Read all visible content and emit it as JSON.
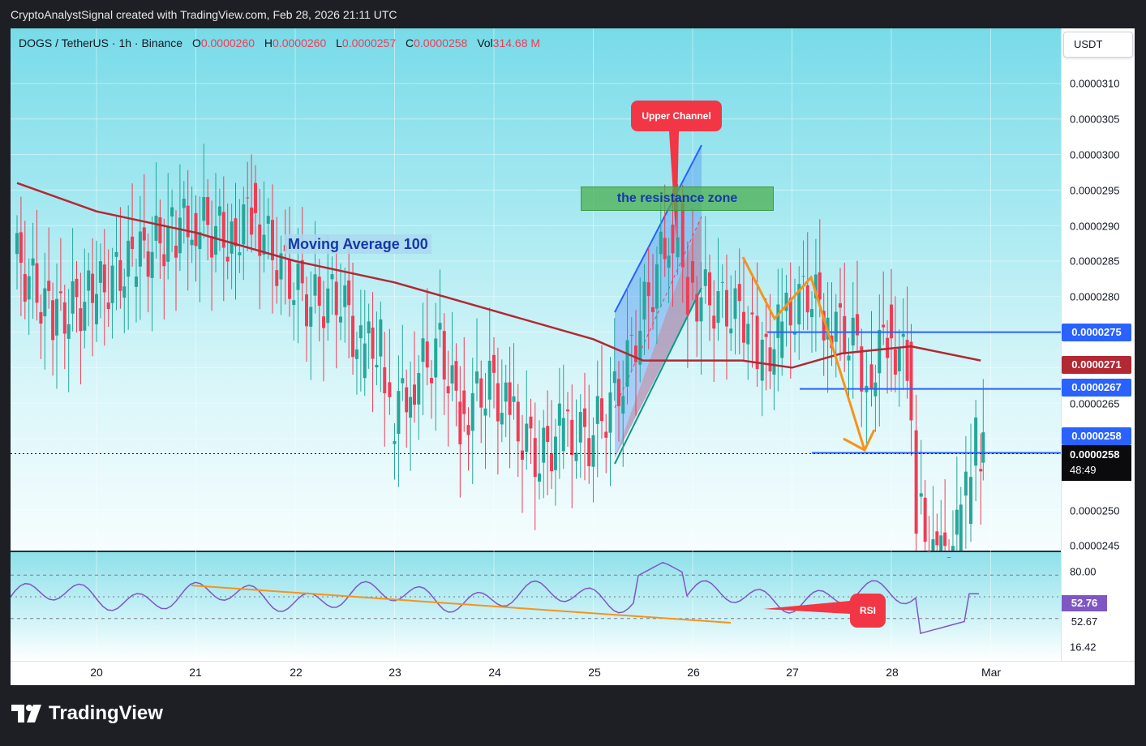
{
  "caption": "CryptoAnalystSignal created with TradingView.com, Feb 28, 2026 21:11 UTC",
  "legend": {
    "symbol": "DOGS / TetherUS · 1h · Binance",
    "o_label": "O",
    "o_value": "0.0000260",
    "h_label": "H",
    "h_value": "0.0000260",
    "l_label": "L",
    "l_value": "0.0000257",
    "c_label": "C",
    "c_value": "0.0000258",
    "vol_label": "Vol",
    "vol_value": "314.68 M"
  },
  "currency_button": "USDT",
  "price_axis_ticks": [
    "0.0000310",
    "0.0000305",
    "0.0000300",
    "0.0000295",
    "0.0000290",
    "0.0000285",
    "0.0000280",
    "0.0000265",
    "0.0000250",
    "0.0000245"
  ],
  "price_tags": {
    "level_275": "0.0000275",
    "ma_271": "0.0000271",
    "level_267": "0.0000267",
    "last_258": "0.0000258",
    "current_price": "0.0000258",
    "countdown": "48:49"
  },
  "rsi_axis": {
    "upper": "80.00",
    "rsi_value": "52.76",
    "ma_value": "52.67",
    "low": "16.42"
  },
  "time_axis": [
    "20",
    "21",
    "22",
    "23",
    "24",
    "25",
    "26",
    "27",
    "28",
    "Mar"
  ],
  "annotations": {
    "moving_average": "Moving Average 100",
    "resistance_zone": "the resistance zone",
    "upper_channel": "Upper Channel",
    "rsi_callout": "RSI"
  },
  "brand": "TradingView",
  "colors": {
    "up": "#26a69a",
    "down": "#ef3d56",
    "ma": "#b22833",
    "level_line": "#2962ff",
    "arrow": "#f7931a"
  },
  "chart_data": {
    "type": "candlestick",
    "interval": "1h",
    "title": "DOGS / TetherUS · 1h · Binance",
    "x_labels": [
      "20",
      "21",
      "22",
      "23",
      "24",
      "25",
      "26",
      "27",
      "28",
      "Mar"
    ],
    "price_path": [
      [
        "19.2",
        2.86e-05
      ],
      [
        "19.6",
        2.77e-05
      ],
      [
        "20.0",
        2.8e-05
      ],
      [
        "20.4",
        2.85e-05
      ],
      [
        "20.8",
        2.89e-05
      ],
      [
        "21.0",
        2.91e-05
      ],
      [
        "21.4",
        2.88e-05
      ],
      [
        "21.6",
        2.92e-05
      ],
      [
        "21.9",
        2.84e-05
      ],
      [
        "22.2",
        2.79e-05
      ],
      [
        "22.5",
        2.8e-05
      ],
      [
        "22.7",
        2.72e-05
      ],
      [
        "22.9",
        2.74e-05
      ],
      [
        "23.0",
        2.62e-05
      ],
      [
        "23.2",
        2.68e-05
      ],
      [
        "23.5",
        2.73e-05
      ],
      [
        "23.7",
        2.63e-05
      ],
      [
        "24.0",
        2.68e-05
      ],
      [
        "24.2",
        2.63e-05
      ],
      [
        "24.5",
        2.57e-05
      ],
      [
        "24.7",
        2.61e-05
      ],
      [
        "25.0",
        2.6e-05
      ],
      [
        "25.3",
        2.67e-05
      ],
      [
        "25.6",
        2.8e-05
      ],
      [
        "25.8",
        2.89e-05
      ],
      [
        "25.9",
        2.9e-05
      ],
      [
        "26.0",
        2.81e-05
      ],
      [
        "26.3",
        2.79e-05
      ],
      [
        "26.6",
        2.77e-05
      ],
      [
        "26.7",
        2.7e-05
      ],
      [
        "26.9",
        2.75e-05
      ],
      [
        "27.2",
        2.81e-05
      ],
      [
        "27.4",
        2.77e-05
      ],
      [
        "27.7",
        2.73e-05
      ],
      [
        "27.8",
        2.68e-05
      ],
      [
        "28.0",
        2.75e-05
      ],
      [
        "28.2",
        2.7e-05
      ],
      [
        "28.3",
        2.5e-05
      ],
      [
        "28.5",
        2.42e-05
      ],
      [
        "28.7",
        2.46e-05
      ],
      [
        "28.8",
        2.52e-05
      ],
      [
        "28.9",
        2.59e-05
      ],
      [
        "28.95",
        2.58e-05
      ]
    ],
    "moving_average_100": [
      [
        "19.2",
        2.96e-05
      ],
      [
        "20.0",
        2.92e-05
      ],
      [
        "21.0",
        2.89e-05
      ],
      [
        "22.0",
        2.85e-05
      ],
      [
        "23.0",
        2.82e-05
      ],
      [
        "24.0",
        2.78e-05
      ],
      [
        "25.0",
        2.74e-05
      ],
      [
        "25.5",
        2.71e-05
      ],
      [
        "26.5",
        2.71e-05
      ],
      [
        "27.0",
        2.7e-05
      ],
      [
        "27.5",
        2.72e-05
      ],
      [
        "28.2",
        2.73e-05
      ],
      [
        "28.9",
        2.71e-05
      ]
    ],
    "levels": {
      "level_275": 2.75e-05,
      "ma_271": 2.71e-05,
      "level_267": 2.67e-05,
      "last_258": 2.58e-05
    },
    "rsi": {
      "upper_band": 70,
      "lower_band": 30,
      "value": 52.76,
      "ma_value": 52.67,
      "axis_labels": [
        "80.00",
        "52.76",
        "52.67",
        "16.42"
      ]
    }
  }
}
